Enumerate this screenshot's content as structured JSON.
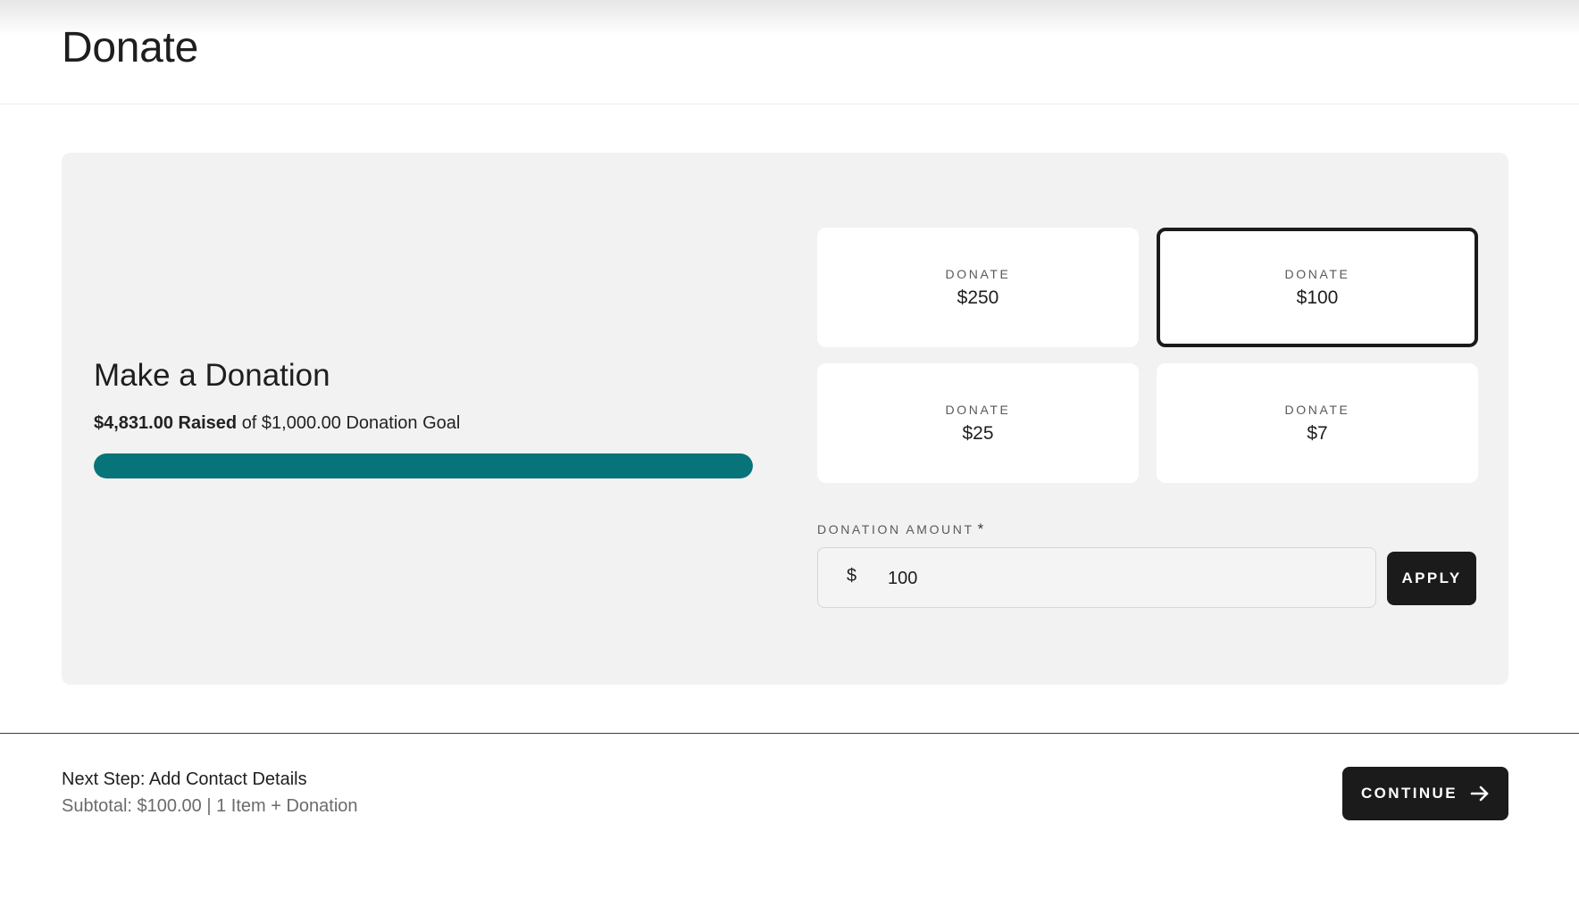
{
  "header": {
    "title": "Donate"
  },
  "donation": {
    "title": "Make a Donation",
    "raised_amount": "$4,831.00 Raised",
    "goal_text": "of $1,000.00 Donation Goal",
    "progress_fraction": 1.0,
    "progress_color": "#07747a",
    "options": [
      {
        "label": "DONATE",
        "value": "$250",
        "selected": false
      },
      {
        "label": "DONATE",
        "value": "$100",
        "selected": true
      },
      {
        "label": "DONATE",
        "value": "$25",
        "selected": false
      },
      {
        "label": "DONATE",
        "value": "$7",
        "selected": false
      }
    ],
    "amount_field": {
      "label": "DONATION AMOUNT",
      "required_mark": "*",
      "currency": "$",
      "value": "100"
    },
    "apply_label": "APPLY"
  },
  "footer": {
    "next_step": "Next Step: Add Contact Details",
    "subtotal": "Subtotal: $100.00 | 1 Item + Donation",
    "continue_label": "CONTINUE",
    "continue_icon": "arrow-right-icon"
  }
}
